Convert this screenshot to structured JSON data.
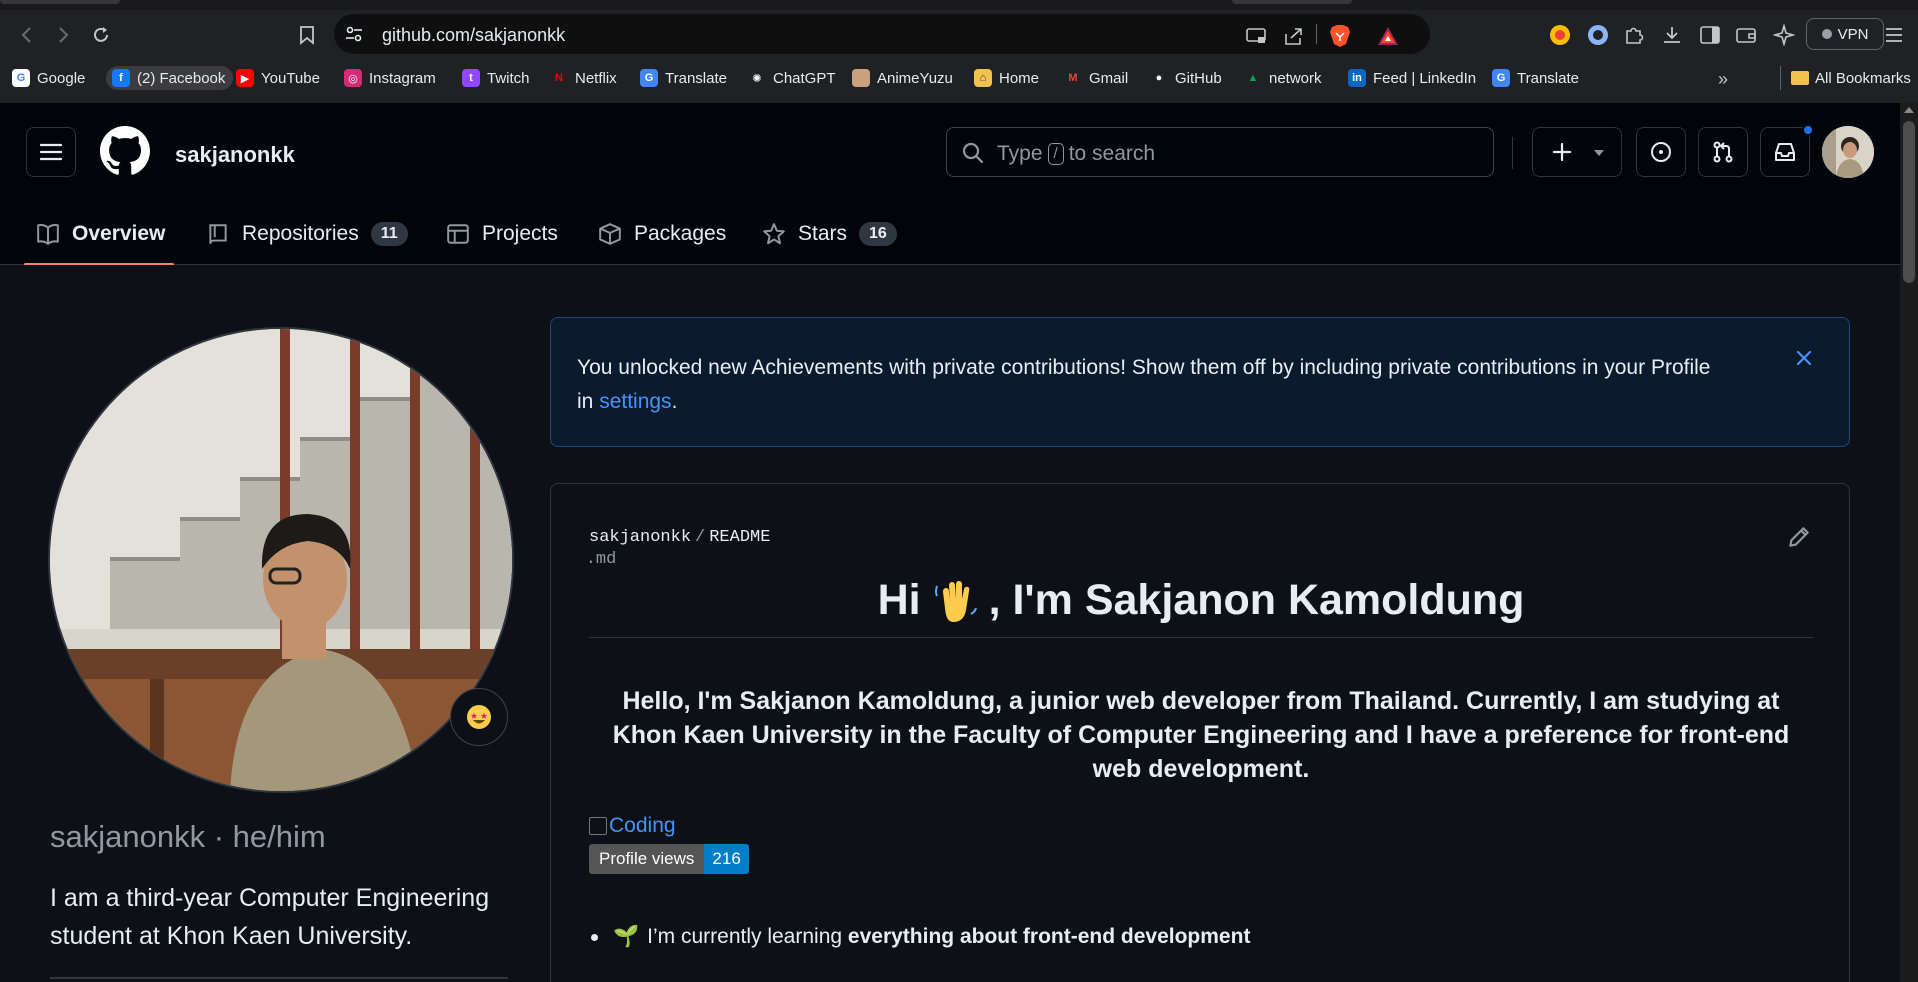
{
  "browser": {
    "url": "github.com/sakjanonkk",
    "vpn_label": "VPN",
    "bookmarks": [
      {
        "label": "Google",
        "color": "#ffffff",
        "glyph": "G",
        "glyph_color": "#4285f4"
      },
      {
        "label": "(2) Facebook",
        "color": "#1877f2",
        "glyph": "f"
      },
      {
        "label": "YouTube",
        "color": "#ff0000",
        "glyph": "▶"
      },
      {
        "label": "Instagram",
        "color": "#d62976",
        "glyph": "◎"
      },
      {
        "label": "Twitch",
        "color": "#9146ff",
        "glyph": "t"
      },
      {
        "label": "Netflix",
        "color": "#202124",
        "glyph": "N",
        "glyph_color": "#e50914"
      },
      {
        "label": "Translate",
        "color": "#4285f4",
        "glyph": "G"
      },
      {
        "label": "ChatGPT",
        "color": "#202124",
        "glyph": "✺",
        "glyph_color": "#ffffff"
      },
      {
        "label": "AnimeYuzu",
        "color": "#c9a27d",
        "glyph": ""
      },
      {
        "label": "Home",
        "color": "#f2c14e",
        "glyph": "⌂",
        "glyph_color": "#3c4043"
      },
      {
        "label": "Gmail",
        "color": "#202124",
        "glyph": "M",
        "glyph_color": "#ea4335"
      },
      {
        "label": "GitHub",
        "color": "#202124",
        "glyph": "●",
        "glyph_color": "#ffffff"
      },
      {
        "label": "network",
        "color": "#202124",
        "glyph": "▲",
        "glyph_color": "#0f9d58"
      },
      {
        "label": "Feed | LinkedIn",
        "color": "#0a66c2",
        "glyph": "in"
      },
      {
        "label": "Translate",
        "color": "#4285f4",
        "glyph": "G"
      }
    ],
    "all_bookmarks_label": "All Bookmarks",
    "accent": "#1f6feb"
  },
  "header": {
    "username": "sakjanonkk",
    "search_placeholder_before": "Type",
    "search_key": "/",
    "search_placeholder_after": "to search"
  },
  "tabs": [
    {
      "label": "Overview",
      "icon": "book-icon",
      "count": null
    },
    {
      "label": "Repositories",
      "icon": "repo-icon",
      "count": "11"
    },
    {
      "label": "Projects",
      "icon": "table-icon",
      "count": null
    },
    {
      "label": "Packages",
      "icon": "package-icon",
      "count": null
    },
    {
      "label": "Stars",
      "icon": "star-icon",
      "count": "16"
    }
  ],
  "profile": {
    "nickname": "sakjanonkk · he/him",
    "bio": "I am a third-year Computer Engineering student at Khon Kaen University."
  },
  "flash": {
    "text_before_link": "You unlocked new Achievements with private contributions! Show them off by including private contributions in your Profile in ",
    "link_text": "settings",
    "text_after_link": "."
  },
  "readme": {
    "owner": "sakjanonkk",
    "file_name": "README",
    "file_ext": ".md",
    "heading_before_emoji": "Hi",
    "heading_after_emoji": ", I'm Sakjanon Kamoldung",
    "intro": "Hello, I'm Sakjanon Kamoldung, a junior web developer from Thailand. Currently, I am studying at Khon Kaen University in the Faculty of Computer Engineering and I have a preference for front-end web development.",
    "coding_alt": "Coding",
    "views_label": "Profile views",
    "views_count": "216",
    "bullets": [
      {
        "emoji": "🌱",
        "text": "I’m currently learning ",
        "bold": "everything about front-end development"
      }
    ]
  }
}
